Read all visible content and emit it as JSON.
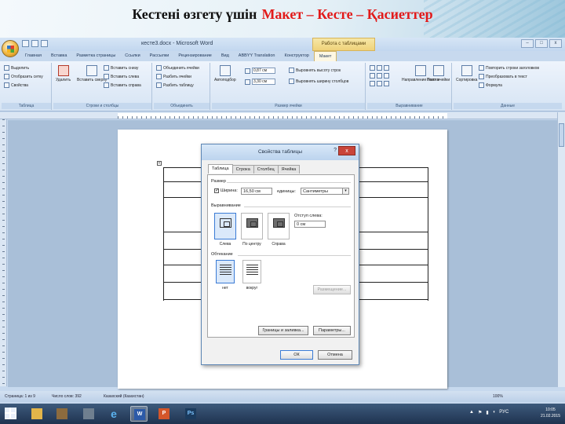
{
  "slide": {
    "title_prefix": "Кестені өзгету үшін",
    "title_highlight": "Макет – Кесте – Қасиеттер"
  },
  "window": {
    "title": "кесте3.docx - Microsoft Word",
    "context_tab": "Работа с таблицами",
    "controls": {
      "minimize": "–",
      "maximize": "□",
      "close": "x"
    }
  },
  "ribbon_tabs": [
    "Главная",
    "Вставка",
    "Разметка страницы",
    "Ссылки",
    "Рассылки",
    "Рецензирование",
    "Вид",
    "ABBYY Translation",
    "Конструктор",
    "Макет"
  ],
  "ribbon": {
    "table": {
      "label": "Таблица",
      "items": [
        "Выделить",
        "Отобразить сетку",
        "Свойства"
      ]
    },
    "rows_cols": {
      "label": "Строки и столбцы",
      "delete": "Удалить",
      "insert_above": "Вставить сверху",
      "items": [
        "Вставить снизу",
        "Вставить слева",
        "Вставить справа"
      ]
    },
    "merge": {
      "label": "Объединить",
      "items": [
        "Объединить ячейки",
        "Разбить ячейки",
        "Разбить таблицу"
      ]
    },
    "cell_size": {
      "label": "Размер ячейки",
      "autofit": "Автоподбор",
      "height": "0,87 см",
      "width": "3,30 см",
      "items": [
        "Выровнять высоту строк",
        "Выровнять ширину столбцов"
      ]
    },
    "alignment": {
      "label": "Выравнивание",
      "text_dir": "Направление текста",
      "margins": "Поля ячейки"
    },
    "data": {
      "label": "Данные",
      "sort": "Сортировка",
      "items": [
        "Повторить строки заголовков",
        "Преобразовать в текст",
        "Формула"
      ]
    }
  },
  "dialog": {
    "title": "Свойства таблицы",
    "help": "?",
    "close": "x",
    "tabs": [
      "Таблица",
      "Строка",
      "Столбец",
      "Ячейка"
    ],
    "size_label": "Размер",
    "width_checkbox": "Ширина:",
    "width_value": "16,50 см",
    "units_label": "единицы:",
    "units_value": "Сантиметры",
    "alignment_label": "Выравнивание",
    "indent_label": "Отступ слева:",
    "indent_value": "0 см",
    "align_options": [
      "Слева",
      "По центру",
      "Справа"
    ],
    "wrap_label": "Обтекание",
    "wrap_options": [
      "нет",
      "вокруг"
    ],
    "positioning_button": "Размещение...",
    "borders_button": "Границы и заливка...",
    "params_button": "Параметры...",
    "ok_button": "ОК",
    "cancel_button": "Отмена"
  },
  "statusbar": {
    "page": "Страница: 1 из 9",
    "words": "Число слов: 392",
    "lang": "Казахский (Казахстан)",
    "zoom": "100%"
  },
  "taskbar": {
    "lang": "РУС",
    "time": "10:05",
    "date": "21.02.2015"
  }
}
